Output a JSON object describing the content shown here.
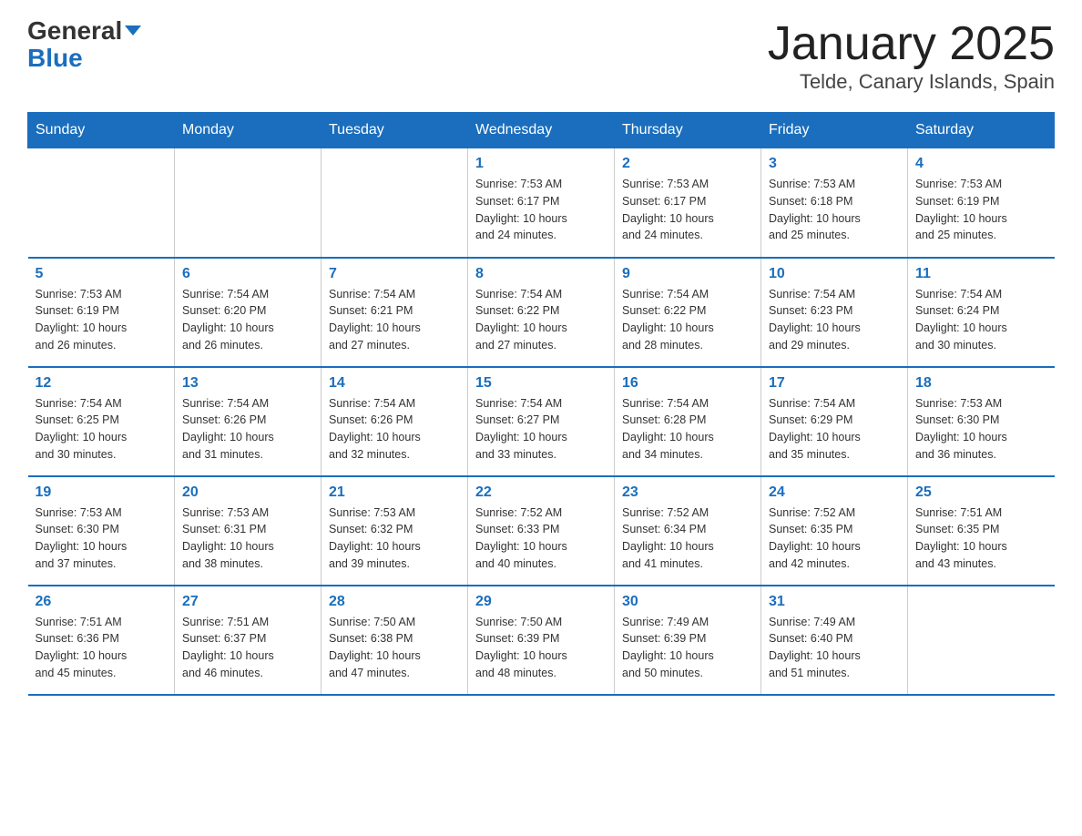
{
  "header": {
    "logo_general": "General",
    "logo_blue": "Blue",
    "title": "January 2025",
    "subtitle": "Telde, Canary Islands, Spain"
  },
  "days_of_week": [
    "Sunday",
    "Monday",
    "Tuesday",
    "Wednesday",
    "Thursday",
    "Friday",
    "Saturday"
  ],
  "weeks": [
    [
      {
        "day": "",
        "info": ""
      },
      {
        "day": "",
        "info": ""
      },
      {
        "day": "",
        "info": ""
      },
      {
        "day": "1",
        "info": "Sunrise: 7:53 AM\nSunset: 6:17 PM\nDaylight: 10 hours\nand 24 minutes."
      },
      {
        "day": "2",
        "info": "Sunrise: 7:53 AM\nSunset: 6:17 PM\nDaylight: 10 hours\nand 24 minutes."
      },
      {
        "day": "3",
        "info": "Sunrise: 7:53 AM\nSunset: 6:18 PM\nDaylight: 10 hours\nand 25 minutes."
      },
      {
        "day": "4",
        "info": "Sunrise: 7:53 AM\nSunset: 6:19 PM\nDaylight: 10 hours\nand 25 minutes."
      }
    ],
    [
      {
        "day": "5",
        "info": "Sunrise: 7:53 AM\nSunset: 6:19 PM\nDaylight: 10 hours\nand 26 minutes."
      },
      {
        "day": "6",
        "info": "Sunrise: 7:54 AM\nSunset: 6:20 PM\nDaylight: 10 hours\nand 26 minutes."
      },
      {
        "day": "7",
        "info": "Sunrise: 7:54 AM\nSunset: 6:21 PM\nDaylight: 10 hours\nand 27 minutes."
      },
      {
        "day": "8",
        "info": "Sunrise: 7:54 AM\nSunset: 6:22 PM\nDaylight: 10 hours\nand 27 minutes."
      },
      {
        "day": "9",
        "info": "Sunrise: 7:54 AM\nSunset: 6:22 PM\nDaylight: 10 hours\nand 28 minutes."
      },
      {
        "day": "10",
        "info": "Sunrise: 7:54 AM\nSunset: 6:23 PM\nDaylight: 10 hours\nand 29 minutes."
      },
      {
        "day": "11",
        "info": "Sunrise: 7:54 AM\nSunset: 6:24 PM\nDaylight: 10 hours\nand 30 minutes."
      }
    ],
    [
      {
        "day": "12",
        "info": "Sunrise: 7:54 AM\nSunset: 6:25 PM\nDaylight: 10 hours\nand 30 minutes."
      },
      {
        "day": "13",
        "info": "Sunrise: 7:54 AM\nSunset: 6:26 PM\nDaylight: 10 hours\nand 31 minutes."
      },
      {
        "day": "14",
        "info": "Sunrise: 7:54 AM\nSunset: 6:26 PM\nDaylight: 10 hours\nand 32 minutes."
      },
      {
        "day": "15",
        "info": "Sunrise: 7:54 AM\nSunset: 6:27 PM\nDaylight: 10 hours\nand 33 minutes."
      },
      {
        "day": "16",
        "info": "Sunrise: 7:54 AM\nSunset: 6:28 PM\nDaylight: 10 hours\nand 34 minutes."
      },
      {
        "day": "17",
        "info": "Sunrise: 7:54 AM\nSunset: 6:29 PM\nDaylight: 10 hours\nand 35 minutes."
      },
      {
        "day": "18",
        "info": "Sunrise: 7:53 AM\nSunset: 6:30 PM\nDaylight: 10 hours\nand 36 minutes."
      }
    ],
    [
      {
        "day": "19",
        "info": "Sunrise: 7:53 AM\nSunset: 6:30 PM\nDaylight: 10 hours\nand 37 minutes."
      },
      {
        "day": "20",
        "info": "Sunrise: 7:53 AM\nSunset: 6:31 PM\nDaylight: 10 hours\nand 38 minutes."
      },
      {
        "day": "21",
        "info": "Sunrise: 7:53 AM\nSunset: 6:32 PM\nDaylight: 10 hours\nand 39 minutes."
      },
      {
        "day": "22",
        "info": "Sunrise: 7:52 AM\nSunset: 6:33 PM\nDaylight: 10 hours\nand 40 minutes."
      },
      {
        "day": "23",
        "info": "Sunrise: 7:52 AM\nSunset: 6:34 PM\nDaylight: 10 hours\nand 41 minutes."
      },
      {
        "day": "24",
        "info": "Sunrise: 7:52 AM\nSunset: 6:35 PM\nDaylight: 10 hours\nand 42 minutes."
      },
      {
        "day": "25",
        "info": "Sunrise: 7:51 AM\nSunset: 6:35 PM\nDaylight: 10 hours\nand 43 minutes."
      }
    ],
    [
      {
        "day": "26",
        "info": "Sunrise: 7:51 AM\nSunset: 6:36 PM\nDaylight: 10 hours\nand 45 minutes."
      },
      {
        "day": "27",
        "info": "Sunrise: 7:51 AM\nSunset: 6:37 PM\nDaylight: 10 hours\nand 46 minutes."
      },
      {
        "day": "28",
        "info": "Sunrise: 7:50 AM\nSunset: 6:38 PM\nDaylight: 10 hours\nand 47 minutes."
      },
      {
        "day": "29",
        "info": "Sunrise: 7:50 AM\nSunset: 6:39 PM\nDaylight: 10 hours\nand 48 minutes."
      },
      {
        "day": "30",
        "info": "Sunrise: 7:49 AM\nSunset: 6:39 PM\nDaylight: 10 hours\nand 50 minutes."
      },
      {
        "day": "31",
        "info": "Sunrise: 7:49 AM\nSunset: 6:40 PM\nDaylight: 10 hours\nand 51 minutes."
      },
      {
        "day": "",
        "info": ""
      }
    ]
  ]
}
